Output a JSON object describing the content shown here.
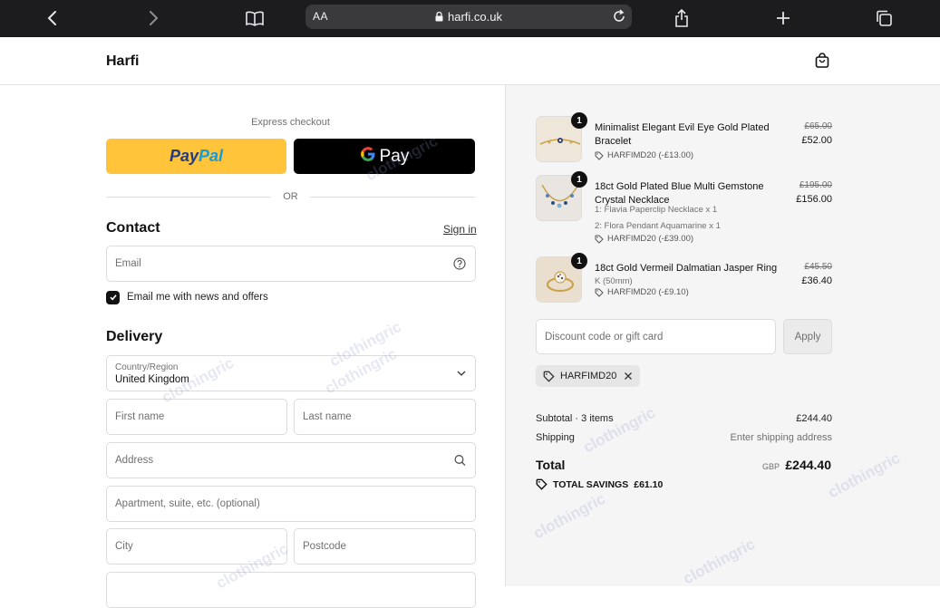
{
  "browser": {
    "text_size_label": "AA",
    "url": "harfi.co.uk"
  },
  "header": {
    "brand": "Harfi"
  },
  "checkout": {
    "express_label": "Express checkout",
    "paypal_left": "Pay",
    "paypal_right": "Pal",
    "gpay_g": "G",
    "gpay_label": "Pay",
    "or_label": "OR",
    "contact": {
      "title": "Contact",
      "signin": "Sign in",
      "email_placeholder": "Email",
      "newsletter_label": "Email me with news and offers",
      "newsletter_checked": true
    },
    "delivery": {
      "title": "Delivery",
      "country_label": "Country/Region",
      "country_value": "United Kingdom",
      "first_name_placeholder": "First name",
      "last_name_placeholder": "Last name",
      "address_placeholder": "Address",
      "apartment_placeholder": "Apartment, suite, etc. (optional)",
      "city_placeholder": "City",
      "postcode_placeholder": "Postcode"
    }
  },
  "summary": {
    "items": [
      {
        "qty": "1",
        "name": "Minimalist Elegant Evil Eye Gold Plated Bracelet",
        "options": [],
        "discount": "HARFIMD20 (-£13.00)",
        "old_price": "£65.00",
        "price": "£52.00"
      },
      {
        "qty": "1",
        "name": "18ct Gold Plated Blue Multi Gemstone Crystal Necklace",
        "options": [
          "1: Flavia Paperclip Necklace x 1",
          "2: Flora Pendant Aquamarine x 1"
        ],
        "discount": "HARFIMD20 (-£39.00)",
        "old_price": "£195.00",
        "price": "£156.00"
      },
      {
        "qty": "1",
        "name": "18ct Gold Vermeil Dalmatian Jasper Ring",
        "options": [
          "K (50mm)"
        ],
        "discount": "HARFIMD20 (-£9.10)",
        "old_price": "£45.50",
        "price": "£36.40"
      }
    ],
    "discount_placeholder": "Discount code or gift card",
    "apply_label": "Apply",
    "applied_code": "HARFIMD20",
    "subtotal_label": "Subtotal · 3 items",
    "subtotal_value": "£244.40",
    "shipping_label": "Shipping",
    "shipping_value": "Enter shipping address",
    "total_label": "Total",
    "total_currency": "GBP",
    "total_value": "£244.40",
    "savings_label": "TOTAL SAVINGS",
    "savings_value": "£61.10"
  },
  "watermark": "clothingric",
  "colors": {
    "paypal_bg": "#ffc439",
    "paypal_dark": "#253b80",
    "paypal_light": "#179bd7",
    "gpay_bg": "#000000",
    "summary_bg": "#f5f5f5"
  }
}
